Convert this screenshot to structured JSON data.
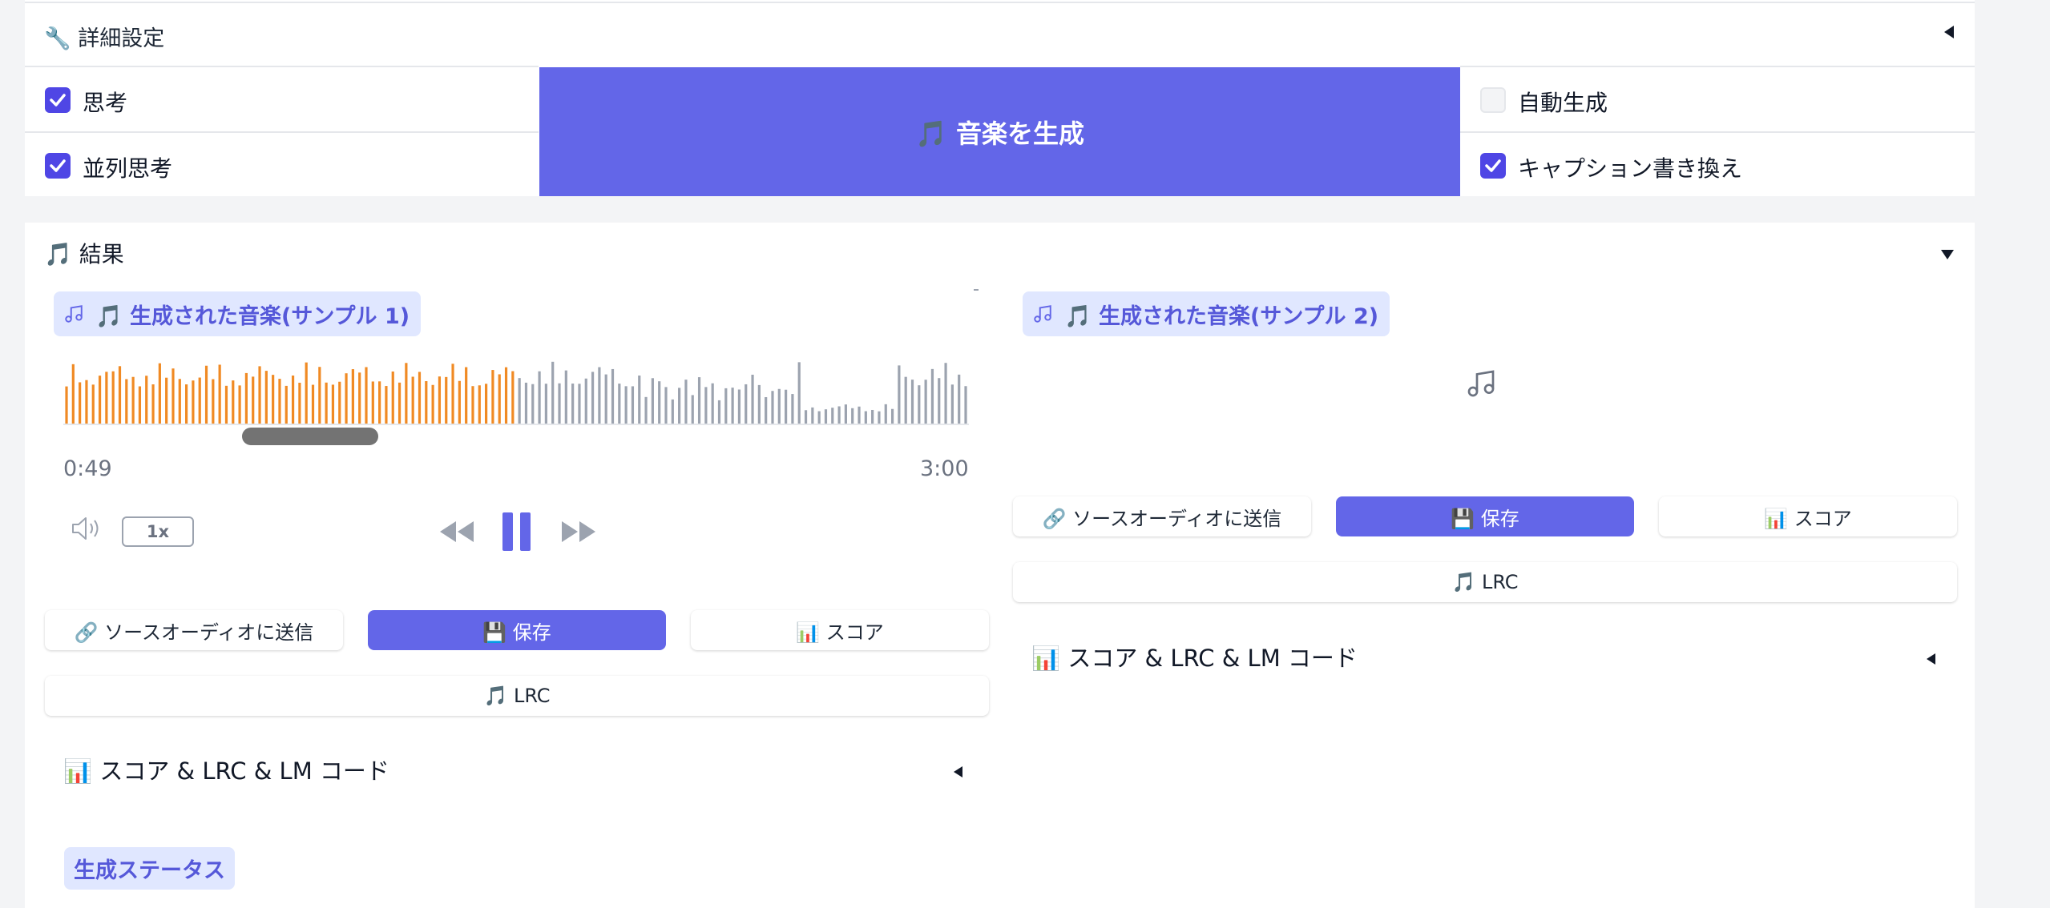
{
  "advanced": {
    "title": "🔧 詳細設定",
    "options_left": [
      {
        "label": "思考",
        "checked": true
      },
      {
        "label": "並列思考",
        "checked": true
      }
    ],
    "options_right": [
      {
        "label": "自動生成",
        "checked": false
      },
      {
        "label": "キャプション書き換え",
        "checked": true
      }
    ],
    "generate_button": "🎵 音楽を生成"
  },
  "results": {
    "title": "🎵 結果",
    "sample1": {
      "label": "🎵 生成された音楽(サンプル 1)",
      "current_time": "0:49",
      "duration": "3:00",
      "playback_progress": 0.5,
      "speed": "1x",
      "buttons": {
        "send": "🔗 ソースオーディオに送信",
        "save": "💾 保存",
        "score": "📊 スコア",
        "lrc": "🎵 LRC"
      },
      "accordion": "📊 スコア & LRC & LM コード"
    },
    "sample2": {
      "label": "🎵 生成された音楽(サンプル 2)",
      "buttons": {
        "send": "🔗 ソースオーディオに送信",
        "save": "💾 保存",
        "score": "📊 スコア",
        "lrc": "🎵 LRC"
      },
      "accordion": "📊 スコア & LRC & LM コード"
    },
    "status_label": "生成ステータス"
  },
  "colors": {
    "accent": "#6366e8",
    "waveform_played": "#f08a24",
    "waveform_unplayed": "#9ca3af"
  }
}
